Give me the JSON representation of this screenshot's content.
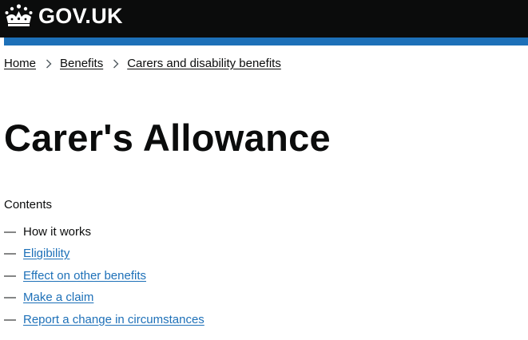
{
  "header": {
    "logo_text": "GOV.UK",
    "brand_color": "#0b0c0c",
    "accent_color": "#1d70b8",
    "crown_icon": "crown-icon"
  },
  "breadcrumbs": [
    {
      "label": "Home"
    },
    {
      "label": "Benefits"
    },
    {
      "label": "Carers and disability benefits"
    }
  ],
  "page": {
    "title": "Carer's Allowance"
  },
  "contents": {
    "heading": "Contents",
    "dash": "—",
    "items": [
      {
        "label": "How it works",
        "current": true
      },
      {
        "label": "Eligibility",
        "current": false
      },
      {
        "label": "Effect on other benefits",
        "current": false
      },
      {
        "label": "Make a claim",
        "current": false
      },
      {
        "label": "Report a change in circumstances",
        "current": false
      }
    ]
  }
}
